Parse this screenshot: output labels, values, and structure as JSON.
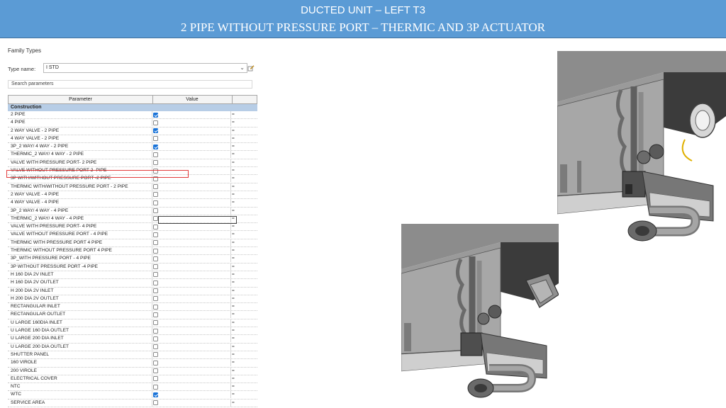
{
  "banner": {
    "line1": "DUCTED UNIT – LEFT T3",
    "line2": "2 PIPE WITHOUT PRESSURE PORT – THERMIC AND 3P ACTUATOR"
  },
  "dialog": {
    "title": "Family Types",
    "type_name_label": "Type name:",
    "type_name_value": "I STD",
    "search_placeholder": "Search parameters",
    "col_parameter": "Parameter",
    "col_value": "Value",
    "group": "Construction",
    "formula_glyph": "=",
    "rows": [
      {
        "name": "2 PIPE",
        "checked": true
      },
      {
        "name": "4 PIPE",
        "checked": false
      },
      {
        "name": "2 WAY VALVE - 2 PIPE",
        "checked": true
      },
      {
        "name": "4 WAY VALVE - 2 PIPE",
        "checked": false
      },
      {
        "name": "3P_2 WAY/ 4 WAY - 2 PIPE",
        "checked": true
      },
      {
        "name": "THERMIC_2 WAY/ 4 WAY - 2 PIPE",
        "checked": false
      },
      {
        "name": "VALVE WITH PRESSURE PORT- 2 PIPE",
        "checked": false
      },
      {
        "name": "VALVE WITHOUT PRESSURE PORT-2- PIPE",
        "checked": false
      },
      {
        "name": "3P WITH/WITHOUT PRESSURE PORT -2 PIPE",
        "checked": false
      },
      {
        "name": "THERMIC WITH/WITHOUT PRESSURE PORT - 2 PIPE",
        "checked": false
      },
      {
        "name": "2 WAY VALVE - 4 PIPE",
        "checked": false
      },
      {
        "name": "4 WAY VALVE - 4 PIPE",
        "checked": false
      },
      {
        "name": "3P_2 WAY/ 4 WAY - 4 PIPE",
        "checked": false
      },
      {
        "name": "THERMIC_2 WAY/ 4 WAY - 4 PIPE",
        "checked": false
      },
      {
        "name": "VALVE WITH PRESSURE PORT- 4 PIPE",
        "checked": false
      },
      {
        "name": "VALVE WITHOUT PRESSURE PORT - 4 PIPE",
        "checked": false
      },
      {
        "name": "THERMIC WITH PRESSURE PORT 4 PIPE",
        "checked": false
      },
      {
        "name": "THERMIC WITHOUT PRESSURE PORT  4 PIPE",
        "checked": false
      },
      {
        "name": "3P_WITH PRESSURE PORT - 4 PIPE",
        "checked": false
      },
      {
        "name": "3P WITHOUT PRESSURE PORT -4  PIPE",
        "checked": false
      },
      {
        "name": "H 160 DIA 2V INLET",
        "checked": false
      },
      {
        "name": "H 160 DIA 2V OUTLET",
        "checked": false
      },
      {
        "name": "H 200 DIA 2V INLET",
        "checked": false
      },
      {
        "name": "H 200 DIA 2V OUTLET",
        "checked": false
      },
      {
        "name": "RECTANGULAR INLET",
        "checked": false
      },
      {
        "name": "RECTANGULAR  OUTLET",
        "checked": false
      },
      {
        "name": "U LARGE 160DIA INLET",
        "checked": false
      },
      {
        "name": "U LARGE 160 DIA OUTLET",
        "checked": false
      },
      {
        "name": "U LARGE 200 DIA INLET",
        "checked": false
      },
      {
        "name": "U LARGE 200 DIA OUTLET",
        "checked": false
      },
      {
        "name": "SHUTTER PANEL",
        "checked": false
      },
      {
        "name": "160 VIROLE",
        "checked": false
      },
      {
        "name": "200 VIROLE",
        "checked": false
      },
      {
        "name": "ELECTRICAL COVER",
        "checked": false
      },
      {
        "name": "NTC",
        "checked": false
      },
      {
        "name": "WTC",
        "checked": true
      },
      {
        "name": "SERVICE AREA",
        "checked": false
      }
    ]
  },
  "colors": {
    "banner_bg": "#5b9bd5",
    "group_bg": "#b7cde6",
    "checkbox_on": "#1a73d8",
    "highlight": "#e23b3b"
  }
}
